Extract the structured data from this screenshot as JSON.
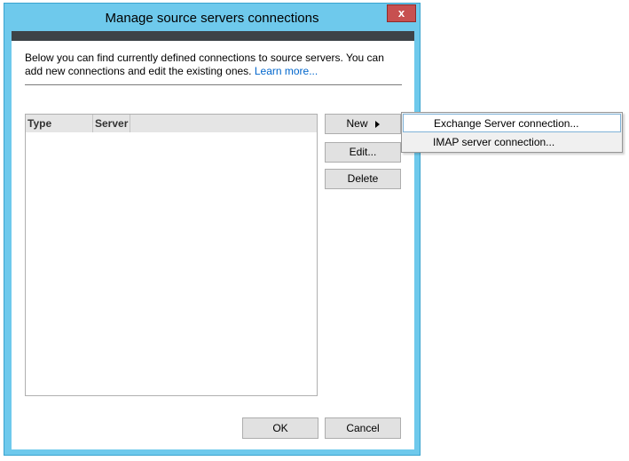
{
  "window": {
    "title": "Manage source servers connections",
    "close_label": "x",
    "accent": "#6ec9ec",
    "close_color": "#c75050"
  },
  "description": {
    "text": "Below you can find currently defined connections to source servers. You can add new connections and edit the existing ones. ",
    "link": "Learn more..."
  },
  "list": {
    "columns": [
      "Type",
      "Server"
    ],
    "rows": []
  },
  "buttons": {
    "new": "New",
    "edit": "Edit...",
    "delete": "Delete",
    "ok": "OK",
    "cancel": "Cancel"
  },
  "new_menu": {
    "items": [
      {
        "label": "Exchange Server connection..."
      },
      {
        "label": "IMAP server connection..."
      }
    ]
  }
}
